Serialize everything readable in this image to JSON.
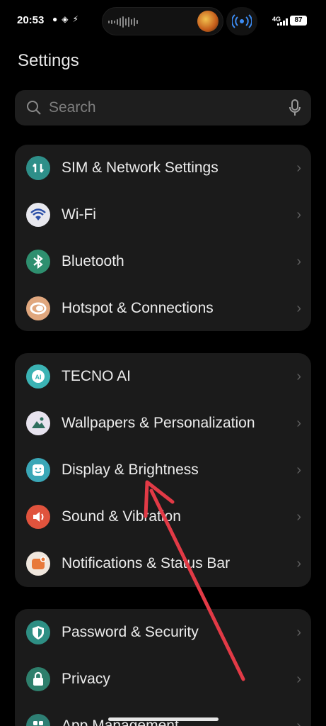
{
  "status_bar": {
    "time": "20:53",
    "network": "4G",
    "battery": "87"
  },
  "header": {
    "title": "Settings"
  },
  "search": {
    "placeholder": "Search"
  },
  "groups": [
    {
      "items": [
        {
          "label": "SIM & Network Settings",
          "icon": "sim-network-icon",
          "color": "#2e8f89"
        },
        {
          "label": "Wi-Fi",
          "icon": "wifi-icon",
          "color": "#e8e8ee"
        },
        {
          "label": "Bluetooth",
          "icon": "bluetooth-icon",
          "color": "#2e8f6f"
        },
        {
          "label": "Hotspot & Connections",
          "icon": "hotspot-icon",
          "color": "#e0a77e"
        }
      ]
    },
    {
      "items": [
        {
          "label": "TECNO AI",
          "icon": "tecno-ai-icon",
          "color": "#3bb3b4"
        },
        {
          "label": "Wallpapers & Personalization",
          "icon": "wallpaper-icon",
          "color": "#e7e3ee"
        },
        {
          "label": "Display & Brightness",
          "icon": "display-icon",
          "color": "#3aa7b7"
        },
        {
          "label": "Sound & Vibration",
          "icon": "sound-icon",
          "color": "#e0533d"
        },
        {
          "label": "Notifications & Status Bar",
          "icon": "notifications-icon",
          "color": "#f0e7de"
        }
      ]
    },
    {
      "items": [
        {
          "label": "Password & Security",
          "icon": "shield-icon",
          "color": "#2e8f84"
        },
        {
          "label": "Privacy",
          "icon": "lock-icon",
          "color": "#2e7f6c"
        },
        {
          "label": "App Management",
          "icon": "apps-icon",
          "color": "#2e7f74"
        }
      ]
    }
  ],
  "annotation": {
    "type": "red-arrow",
    "color": "#e23a46"
  }
}
